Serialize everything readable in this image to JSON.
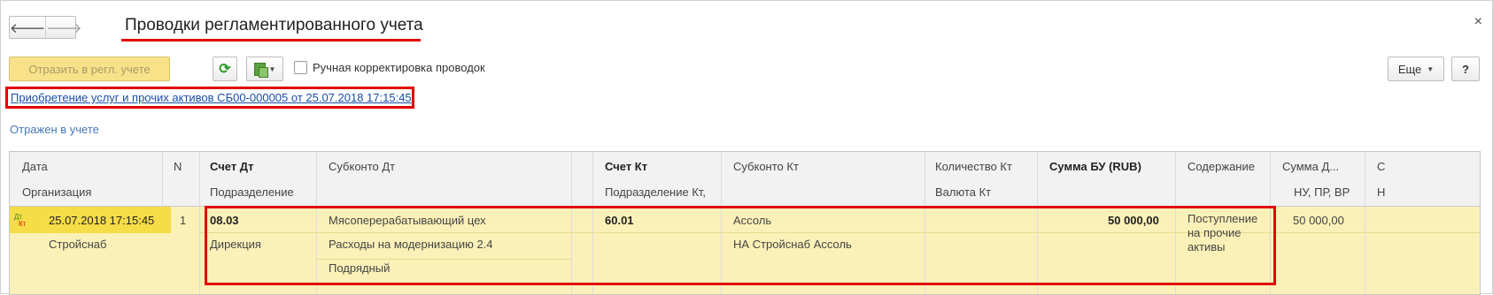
{
  "window": {
    "title": "Проводки регламентированного учета",
    "close_glyph": "×"
  },
  "nav": {
    "back": "🡐",
    "forward": "🡒"
  },
  "toolbar": {
    "post_label": "Отразить в регл. учете",
    "refresh_icon": "refresh-icon",
    "docs_icon": "documents-icon",
    "manual_edit_label": "Ручная корректировка проводок",
    "more_label": "Еще",
    "help_label": "?"
  },
  "document_link": "Приобретение услуг и прочих активов СБ00-000005 от 25.07.2018 17:15:45",
  "status_text": "Отражен в учете",
  "table": {
    "headers_top": {
      "date": "Дата",
      "n": "N",
      "account_dt": "Счет Дт",
      "subconto_dt": "Субконто Дт",
      "account_kt": "Счет Кт",
      "subconto_kt": "Субконто Кт",
      "qty_kt": "Количество Кт",
      "sum_bu": "Сумма БУ (RUB)",
      "content": "Содержание",
      "sum_d": "Сумма Д...",
      "extra": "С"
    },
    "headers_bottom": {
      "org": "Организация",
      "dept": "Подразделение",
      "dept_kt": "Подразделение Кт,",
      "currency_kt": "Валюта Кт",
      "nu_pr_vr": "НУ, ПР, ВР",
      "extra": "Н"
    },
    "rows": [
      {
        "dt_badge": "Дт",
        "kt_badge": "Кт",
        "date": "25.07.2018 17:15:45",
        "n": "1",
        "org": "Стройснаб",
        "account_dt": "08.03",
        "dept": "Дирекция",
        "subconto_dt": [
          "Мясоперерабатывающий цех",
          "Расходы на модернизацию 2.4",
          "Подрядный"
        ],
        "account_kt": "60.01",
        "subconto_kt": [
          "Ассоль",
          "НА Стройснаб Ассоль"
        ],
        "sum_bu": "50 000,00",
        "content": [
          "Поступление",
          "на прочие",
          "активы"
        ],
        "sum_d": "50 000,00"
      }
    ]
  }
}
